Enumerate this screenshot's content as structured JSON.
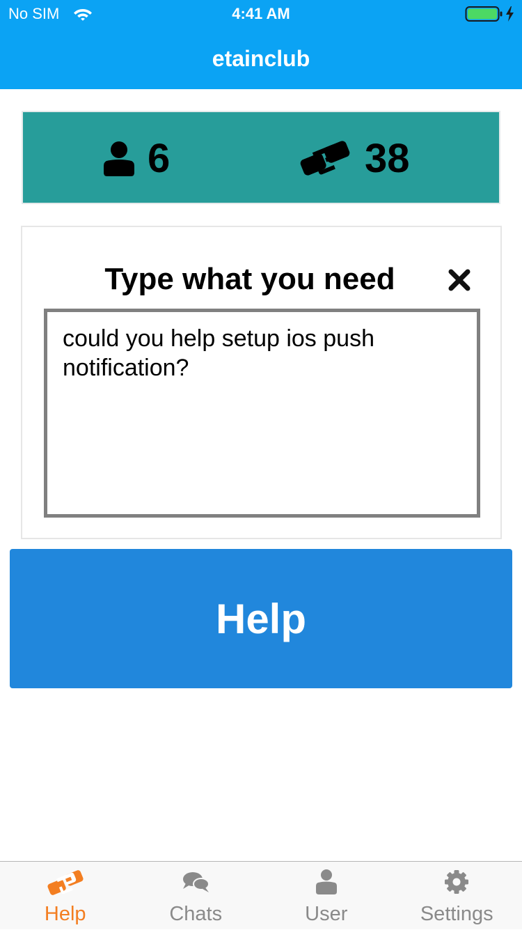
{
  "status_bar": {
    "carrier": "No SIM",
    "time": "4:41 AM"
  },
  "nav": {
    "title": "etainclub"
  },
  "stats": {
    "users_count": "6",
    "helps_count": "38"
  },
  "request": {
    "title": "Type what you need",
    "text": "could you help setup ios push notification?"
  },
  "help_button": {
    "label": "Help"
  },
  "tabs": [
    {
      "label": "Help",
      "icon": "handshake-icon",
      "active": true
    },
    {
      "label": "Chats",
      "icon": "chat-bubbles-icon",
      "active": false
    },
    {
      "label": "User",
      "icon": "user-icon",
      "active": false
    },
    {
      "label": "Settings",
      "icon": "gear-icon",
      "active": false
    }
  ],
  "colors": {
    "header": "#0ba3f4",
    "stats_card": "#279d9a",
    "help_button": "#2187dc",
    "tab_active": "#f37e21",
    "tab_inactive": "#8a8a8a",
    "battery": "#4cd964"
  }
}
